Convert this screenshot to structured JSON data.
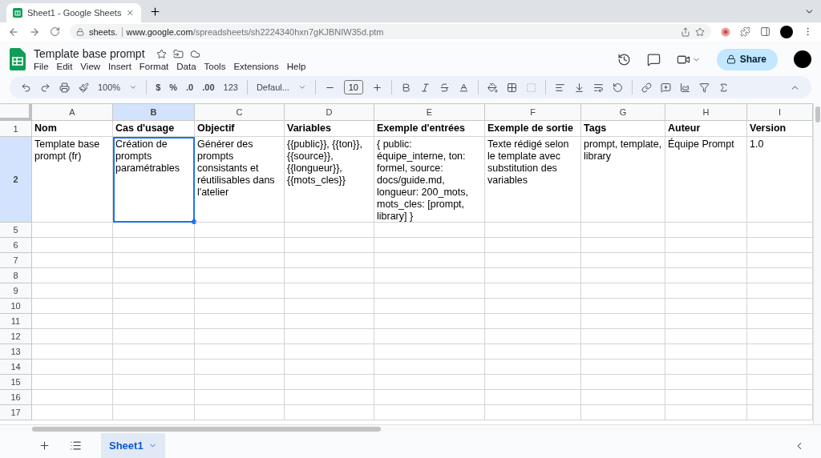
{
  "browser": {
    "tab_title": "Sheet1 - Google Sheets",
    "url_host": "sheets.",
    "url_domain": "www.google.com",
    "url_path": "/spreadsheets/sh2224340hxn7gKJBNIW35d.ptm"
  },
  "document": {
    "title": "Template base prompt",
    "menu": [
      "File",
      "Edit",
      "View",
      "Insert",
      "Format",
      "Data",
      "Tools",
      "Extensions",
      "Help"
    ],
    "share_label": "Share"
  },
  "toolbar": {
    "zoom": "100%",
    "currency": "$",
    "percent": "%",
    "decrease_decimals": ".0",
    "increase_decimals": ".00",
    "number_format": "123",
    "font": "Defaul...",
    "font_size": "10"
  },
  "sheet": {
    "columns": [
      {
        "label": "A",
        "selected": false
      },
      {
        "label": "B",
        "selected": true
      },
      {
        "label": "C",
        "selected": false
      },
      {
        "label": "D",
        "selected": false
      },
      {
        "label": "E",
        "selected": false
      },
      {
        "label": "F",
        "selected": false
      },
      {
        "label": "G",
        "selected": false
      },
      {
        "label": "H",
        "selected": false
      },
      {
        "label": "I",
        "selected": false
      }
    ],
    "rows": [
      {
        "number": "1",
        "selected": false,
        "bold": true,
        "cells": [
          {
            "text": "Nom",
            "selected": false
          },
          {
            "text": "Cas d'usage",
            "selected": false
          },
          {
            "text": "Objectif",
            "selected": false
          },
          {
            "text": "Variables",
            "selected": false
          },
          {
            "text": "Exemple d'entrées",
            "selected": false
          },
          {
            "text": "Exemple de sortie",
            "selected": false
          },
          {
            "text": "Tags",
            "selected": false
          },
          {
            "text": "Auteur",
            "selected": false
          },
          {
            "text": "Version",
            "selected": false
          }
        ]
      },
      {
        "number": "2",
        "selected": true,
        "bold": false,
        "cells": [
          {
            "text": "Template base prompt (fr)",
            "selected": false
          },
          {
            "text": "Création de prompts paramétrables",
            "selected": true
          },
          {
            "text": "Générer des prompts consistants et réutilisables dans l'atelier",
            "selected": false
          },
          {
            "text": "{{public}}, {{ton}}, {{source}}, {{longueur}}, {{mots_cles}}",
            "selected": false
          },
          {
            "text": "{ public: équipe_interne, ton: formel, source: docs/guide.md, longueur: 200_mots, mots_cles: [prompt, library] }",
            "selected": false
          },
          {
            "text": "Texte rédigé selon le template avec substitution des variables",
            "selected": false
          },
          {
            "text": "prompt, template, library",
            "selected": false
          },
          {
            "text": "Équipe Prompt",
            "selected": false
          },
          {
            "text": "1.0",
            "selected": false
          }
        ]
      },
      {
        "number": "5",
        "selected": false
      },
      {
        "number": "6",
        "selected": false
      },
      {
        "number": "7",
        "selected": false
      },
      {
        "number": "8",
        "selected": false
      },
      {
        "number": "9",
        "selected": false
      },
      {
        "number": "10",
        "selected": false
      },
      {
        "number": "11",
        "selected": false
      },
      {
        "number": "12",
        "selected": false
      },
      {
        "number": "13",
        "selected": false
      },
      {
        "number": "14",
        "selected": false
      },
      {
        "number": "15",
        "selected": false
      },
      {
        "number": "16",
        "selected": false
      },
      {
        "number": "17",
        "selected": false
      }
    ]
  },
  "sheet_tabs": [
    {
      "label": "Sheet1",
      "selected": true
    }
  ]
}
